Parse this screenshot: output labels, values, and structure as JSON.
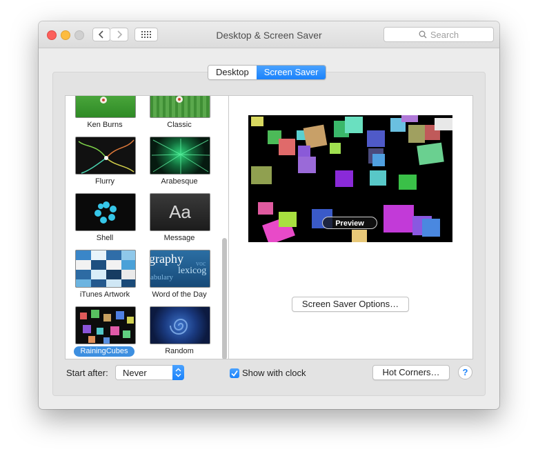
{
  "window": {
    "title": "Desktop & Screen Saver",
    "search_placeholder": "Search"
  },
  "tabs": [
    {
      "label": "Desktop",
      "active": false
    },
    {
      "label": "Screen Saver",
      "active": true
    }
  ],
  "screen_savers": [
    {
      "label": "Ken Burns",
      "icon": "ken-burns-thumbnail"
    },
    {
      "label": "Classic",
      "icon": "classic-thumbnail"
    },
    {
      "label": "Flurry",
      "icon": "flurry-thumbnail"
    },
    {
      "label": "Arabesque",
      "icon": "arabesque-thumbnail"
    },
    {
      "label": "Shell",
      "icon": "shell-thumbnail"
    },
    {
      "label": "Message",
      "icon": "message-thumbnail",
      "thumb_text": "Aa"
    },
    {
      "label": "iTunes Artwork",
      "icon": "itunes-artwork-thumbnail"
    },
    {
      "label": "Word of the Day",
      "icon": "word-of-the-day-thumbnail",
      "thumb_words": [
        "graphy",
        "lexicog",
        "abulary",
        "voc"
      ]
    },
    {
      "label": "RainingCubes",
      "icon": "raining-cubes-thumbnail",
      "selected": true
    },
    {
      "label": "Random",
      "icon": "random-thumbnail"
    }
  ],
  "preview": {
    "button_label": "Preview"
  },
  "options_button": "Screen Saver Options…",
  "start_after": {
    "label": "Start after:",
    "value": "Never"
  },
  "show_clock": {
    "label": "Show with clock",
    "checked": true
  },
  "hot_corners_button": "Hot Corners…",
  "help_button": "?",
  "colors": {
    "accent": "#1a82fb",
    "selection": "#3d8fe0"
  }
}
